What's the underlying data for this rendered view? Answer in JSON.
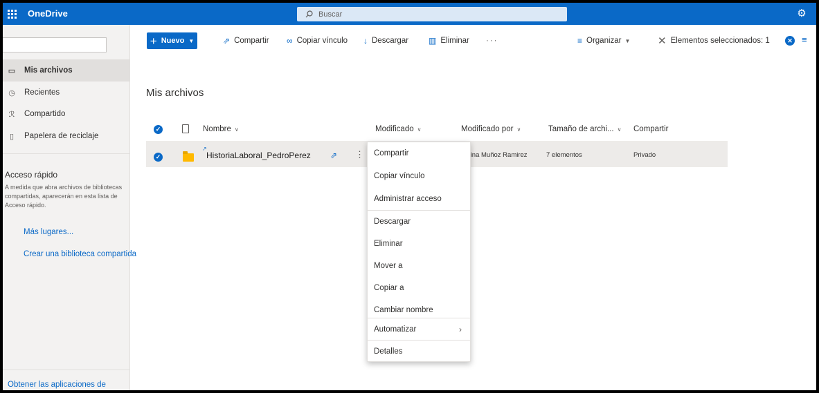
{
  "suitebar": {
    "brand": "OneDrive",
    "search_placeholder": "Buscar"
  },
  "leftnav": {
    "items": [
      {
        "label": "Mis archivos",
        "icon": "folder-icon"
      },
      {
        "label": "Recientes",
        "icon": "clock-icon"
      },
      {
        "label": "Compartido",
        "icon": "people-icon"
      },
      {
        "label": "Papelera de reciclaje",
        "icon": "recycle-bin-icon"
      }
    ],
    "quick_access_title": "Acceso rápido",
    "quick_access_text": "A medida que abra archivos de bibliotecas compartidas, aparecerán en esta lista de Acceso rápido.",
    "more_places": "Más lugares...",
    "create_library": "Crear una biblioteca compartida",
    "get_apps": "Obtener las aplicaciones de"
  },
  "commandbar": {
    "new": "Nuevo",
    "share": "Compartir",
    "copy_link": "Copiar vínculo",
    "download": "Descargar",
    "delete": "Eliminar",
    "more": "···",
    "organize": "Organizar",
    "selected": "Elementos seleccionados: 1"
  },
  "main": {
    "title": "Mis archivos",
    "columns": {
      "name": "Nombre",
      "modified": "Modificado",
      "modified_by": "Modificado por",
      "size": "Tamaño de archi...",
      "sharing": "Compartir"
    },
    "row": {
      "name": "HistoriaLaboral_PedroPerez",
      "modified_by": "Carolina Muñoz Ramirez",
      "size": "7 elementos",
      "sharing": "Privado"
    }
  },
  "context_menu": {
    "items": [
      "Compartir",
      "Copiar vínculo",
      "Administrar acceso",
      "Descargar",
      "Eliminar",
      "Mover a",
      "Copiar a",
      "Cambiar nombre",
      "Automatizar",
      "Detalles"
    ]
  },
  "colors": {
    "brand_blue": "#0a69c7",
    "nav_bg": "#f3f2f1",
    "selected_row": "#edebe9",
    "folder": "#ffb900"
  }
}
